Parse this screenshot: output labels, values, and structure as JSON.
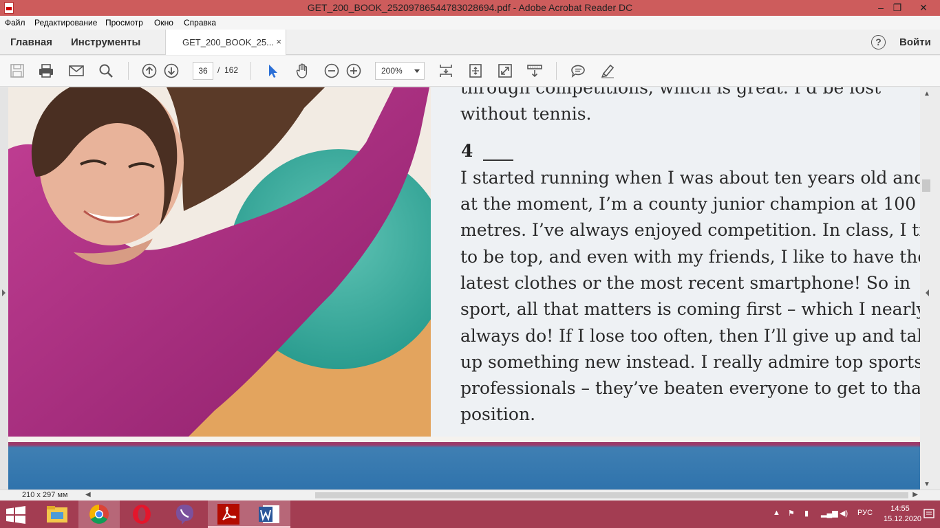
{
  "window": {
    "title": "GET_200_BOOK_25209786544783028694.pdf - Adobe Acrobat Reader DC",
    "controls": {
      "minimize": "–",
      "restore": "❐",
      "close": "✕"
    }
  },
  "menu": [
    "Файл",
    "Редактирование",
    "Просмотр",
    "Окно",
    "Справка"
  ],
  "tabs": {
    "home": "Главная",
    "tools": "Инструменты",
    "document": "GET_200_BOOK_25...",
    "close": "×"
  },
  "header": {
    "help": "?",
    "signin": "Войти"
  },
  "toolbar": {
    "current_page": "36",
    "page_separator": "/",
    "total_pages": "162",
    "zoom": "200%"
  },
  "document": {
    "lines_top": [
      "through competitions, which is great. I’d be lost",
      "without tennis."
    ],
    "exercise_number": "4",
    "paragraph_lines": [
      "I started running when I was about ten years old and,",
      "at the moment, I’m a county junior champion at 100",
      "metres. I’ve always enjoyed competition. In class, I try",
      "to be top, and even with my friends, I like to have the",
      "latest clothes or the most recent smartphone! So in",
      "sport, all that matters is coming first – which I nearly",
      "always do! If I lose too often, then I’ll give up and take",
      "up something new instead. I really admire top sports",
      "professionals – they’ve beaten everyone to get to that",
      "position."
    ]
  },
  "status": {
    "page_size": "210 x 297 мм"
  },
  "taskbar": {
    "language": "РУС",
    "time": "14:55",
    "date": "15.12.2020"
  },
  "colors": {
    "titlebar": "#cd5c5c",
    "taskbar": "#a33d52",
    "toolbar": "#f7f7f7",
    "page_bg": "#eef1f4"
  }
}
